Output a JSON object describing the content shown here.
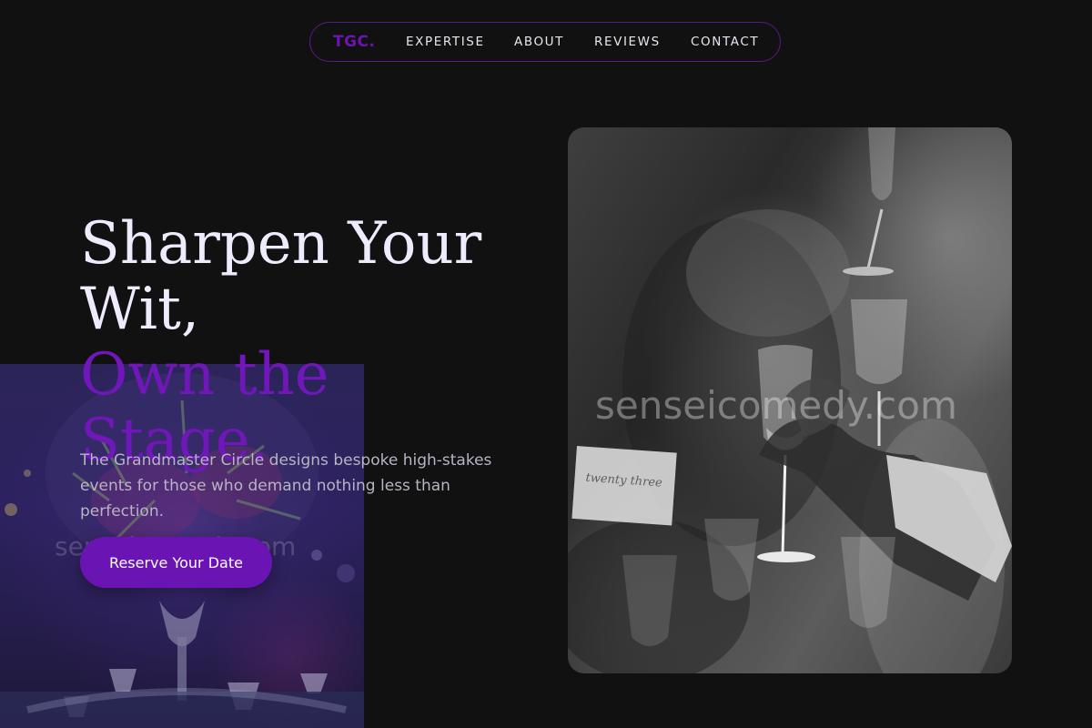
{
  "nav": {
    "logo": "TGC.",
    "links": [
      "EXPERTISE",
      "ABOUT",
      "REVIEWS",
      "CONTACT"
    ]
  },
  "hero": {
    "headline_line1": "Sharpen Your",
    "headline_line2": "Wit,",
    "headline_accent": "Own the Stage.",
    "lead": "The Grandmaster Circle designs bespoke high-stakes events for those who demand nothing less than perfection.",
    "cta_label": "Reserve Your Date"
  },
  "images": {
    "left_background": "table-centerpiece-photo",
    "right_photo": "champagne-toast-photo"
  },
  "watermarks": {
    "text": "senseicomedy.com"
  },
  "colors": {
    "background": "#111112",
    "accent": "#6b14b4",
    "headline": "#efeafc",
    "lead": "#b8b4c3",
    "nav_border": "#5b1a86"
  }
}
